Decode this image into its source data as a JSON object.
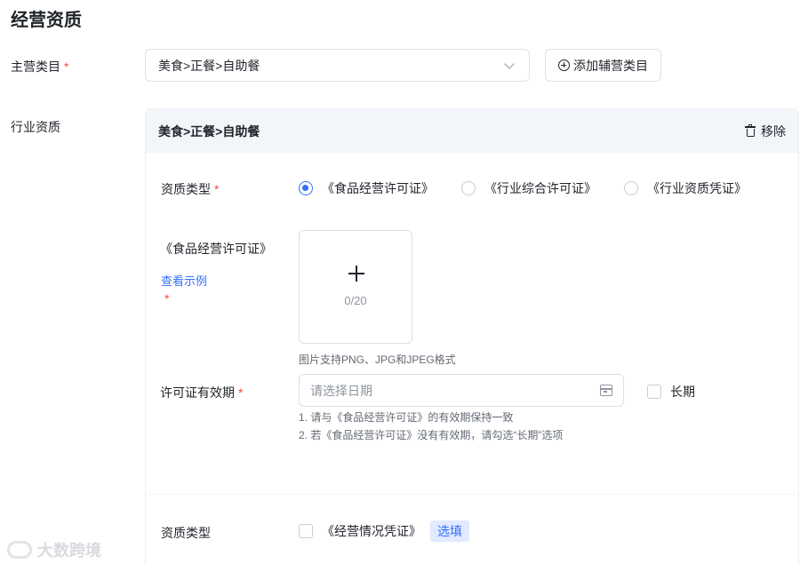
{
  "page_title": "经营资质",
  "main_category": {
    "label": "主营类目",
    "required_mark": "*",
    "selected_value": "美食>正餐>自助餐",
    "add_button_label": "添加辅营类目"
  },
  "industry": {
    "label": "行业资质",
    "panel_category": "美食>正餐>自助餐",
    "remove_label": "移除",
    "qualification_type": {
      "label": "资质类型",
      "required_mark": "*",
      "options": [
        {
          "label": "《食品经营许可证》",
          "selected": true
        },
        {
          "label": "《行业综合许可证》",
          "selected": false
        },
        {
          "label": "《行业资质凭证》",
          "selected": false
        }
      ]
    },
    "license_upload": {
      "label": "《食品经营许可证》",
      "example_link": "查看示例",
      "required_mark": "*",
      "count": "0/20",
      "hint": "图片支持PNG、JPG和JPEG格式"
    },
    "validity": {
      "label": "许可证有效期",
      "required_mark": "*",
      "placeholder": "请选择日期",
      "long_term_label": "长期",
      "long_term_checked": false,
      "notes": [
        "1. 请与《食品经营许可证》的有效期保持一致",
        "2. 若《食品经营许可证》没有有效期，请勾选“长期”选项"
      ]
    },
    "secondary_type": {
      "label": "资质类型",
      "option_label": "《经营情况凭证》",
      "option_checked": false,
      "tag": "选填"
    }
  },
  "watermark_text": "大数跨境",
  "colors": {
    "accent": "#3370ff",
    "required": "#f54a45",
    "panel_header_bg": "#f2f5fa",
    "border": "#dee0e3"
  }
}
